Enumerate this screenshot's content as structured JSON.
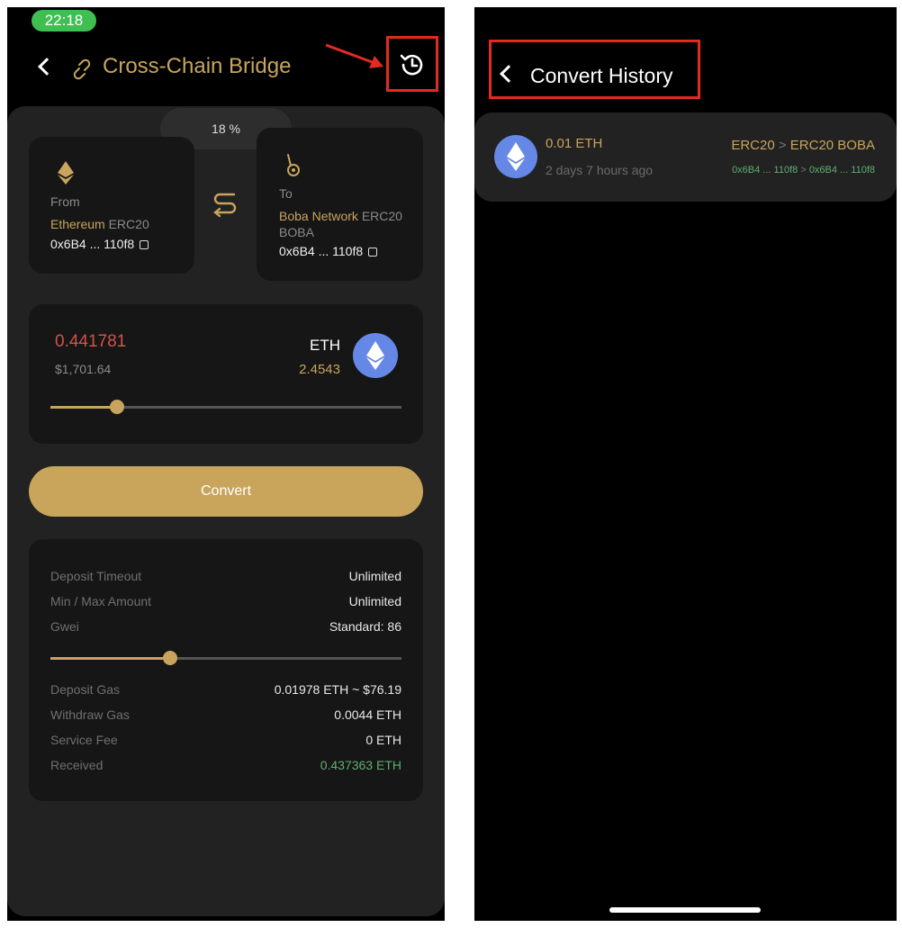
{
  "left": {
    "status_time": "22:18",
    "title": "Cross-Chain Bridge",
    "progress_percent_label": "18 %",
    "from": {
      "label": "From",
      "network": "Ethereum",
      "standard": "ERC20",
      "address": "0x6B4 ... 110f8"
    },
    "to": {
      "label": "To",
      "network": "Boba Network",
      "standard": "ERC20",
      "standard_line2": "BOBA",
      "address": "0x6B4 ... 110f8"
    },
    "amount": {
      "value": "0.441781",
      "usd": "$1,701.64",
      "token": "ETH",
      "balance": "2.4543",
      "slider_fraction": 0.19
    },
    "convert_label": "Convert",
    "info": {
      "rows": [
        {
          "key": "Deposit Timeout",
          "value": "Unlimited"
        },
        {
          "key": "Min / Max Amount",
          "value": "Unlimited"
        },
        {
          "key": "Gwei",
          "value": "Standard: 86"
        }
      ],
      "gwei_slider_fraction": 0.34,
      "gas_rows": [
        {
          "key": "Deposit Gas",
          "value": "0.01978 ETH ~ $76.19"
        },
        {
          "key": "Withdraw Gas",
          "value": "0.0044 ETH"
        },
        {
          "key": "Service Fee",
          "value": "0 ETH"
        },
        {
          "key": "Received",
          "value": "0.437363 ETH"
        }
      ]
    }
  },
  "right": {
    "title": "Convert History",
    "items": [
      {
        "amount": "0.01 ETH",
        "time": "2 days 7 hours ago",
        "from_chain": "ERC20",
        "to_chain": "ERC20 BOBA",
        "separator": ">",
        "from_addr": "0x6B4 ... 110f8",
        "to_addr": "0x6B4 ... 110f8"
      }
    ]
  },
  "colors": {
    "accent_gold": "#c8a45d",
    "red_highlight": "#e32a22",
    "eth_blue": "#6587e6",
    "received_green": "#5fae72",
    "amount_red": "#d0534b"
  },
  "icons": [
    "back-icon",
    "link-icon",
    "history-icon",
    "ethereum-icon",
    "boba-icon",
    "swap-icon",
    "copy-icon"
  ]
}
